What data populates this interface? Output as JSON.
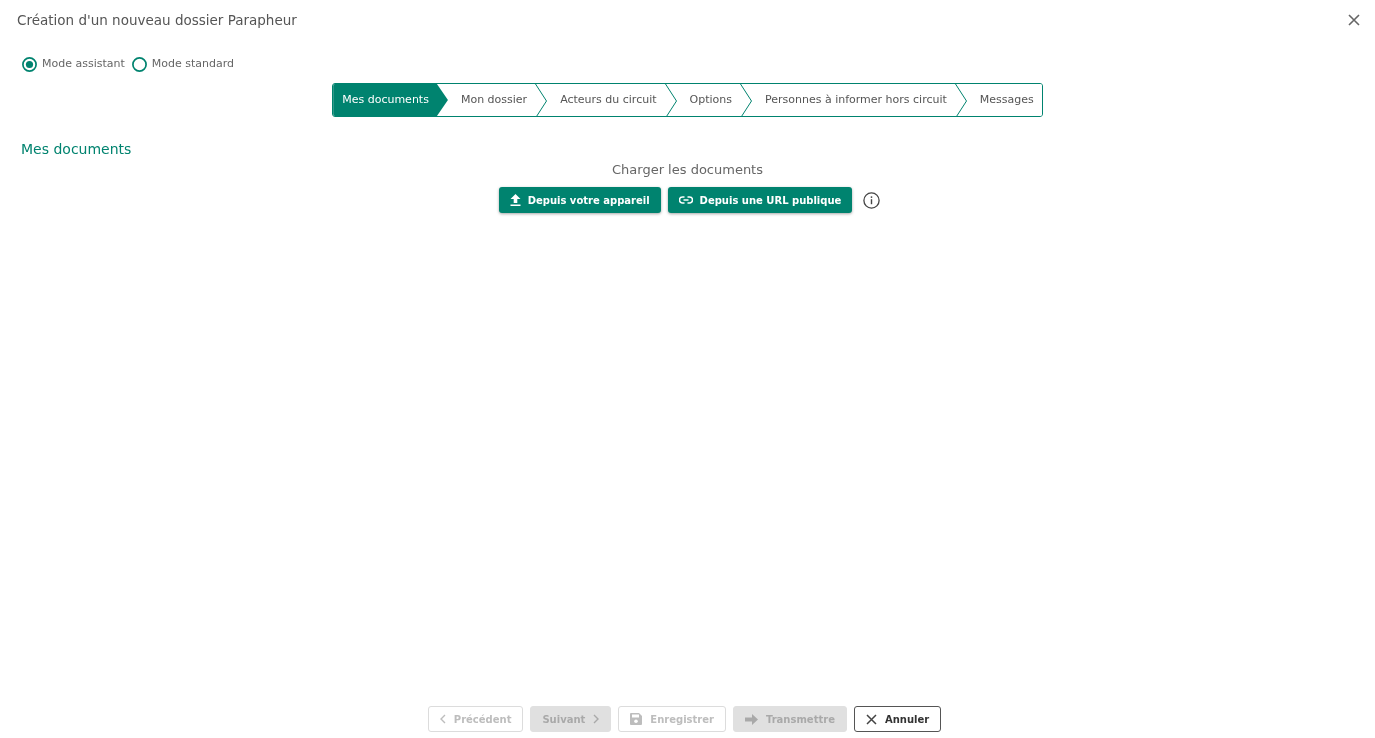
{
  "dialog": {
    "title": "Création d'un nouveau dossier Parapheur"
  },
  "modes": [
    {
      "label": "Mode assistant",
      "selected": true
    },
    {
      "label": "Mode standard",
      "selected": false
    }
  ],
  "steps": [
    {
      "label": "Mes documents",
      "selected": true
    },
    {
      "label": "Mon dossier",
      "selected": false
    },
    {
      "label": "Acteurs du circuit",
      "selected": false
    },
    {
      "label": "Options",
      "selected": false
    },
    {
      "label": "Personnes à informer hors circuit",
      "selected": false
    },
    {
      "label": "Messages",
      "selected": false
    }
  ],
  "section": {
    "title": "Mes documents",
    "upload_prompt": "Charger les documents",
    "upload_buttons": [
      {
        "label": "Depuis votre appareil",
        "kind": "upload"
      },
      {
        "label": "Depuis une URL publique",
        "kind": "link"
      }
    ]
  },
  "footer_buttons": [
    {
      "label": "Précédent",
      "kind": "previous",
      "disabled": true
    },
    {
      "label": "Suivant",
      "kind": "next",
      "disabled": true
    },
    {
      "label": "Enregistrer",
      "kind": "save",
      "disabled": true
    },
    {
      "label": "Transmettre",
      "kind": "send",
      "disabled": true
    },
    {
      "label": "Annuler",
      "kind": "cancel",
      "disabled": false
    }
  ]
}
